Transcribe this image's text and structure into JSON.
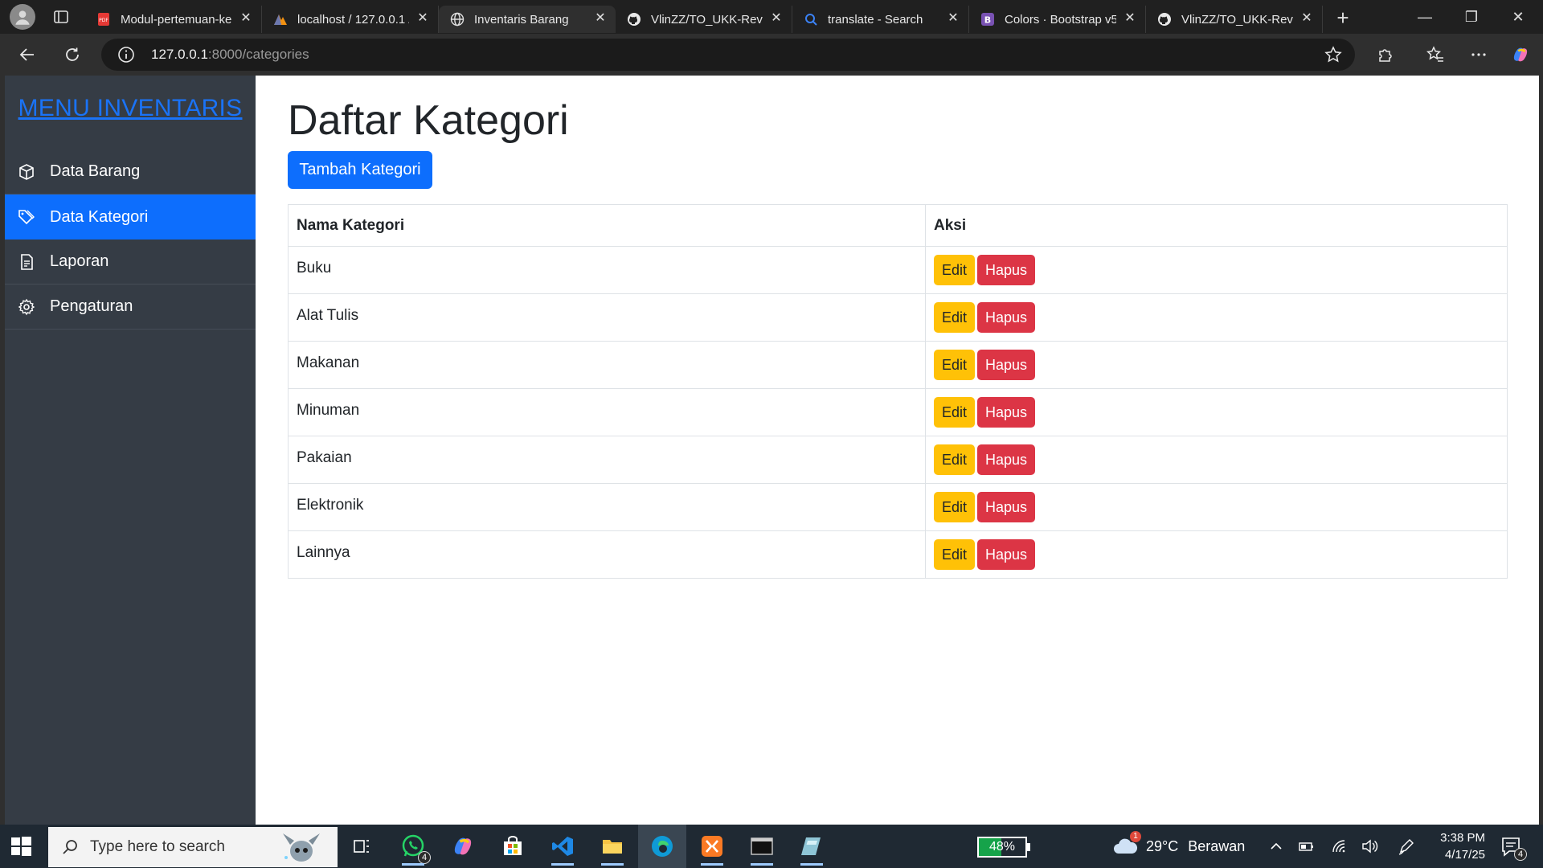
{
  "browser": {
    "tabs": [
      {
        "label": "Modul-pertemuan-ke",
        "icon": "pdf-icon",
        "active": false
      },
      {
        "label": "localhost / 127.0.0.1 /",
        "icon": "phpmyadmin-icon",
        "active": false
      },
      {
        "label": "Inventaris Barang",
        "icon": "globe-icon",
        "active": true
      },
      {
        "label": "VlinZZ/TO_UKK-Revali",
        "icon": "github-icon",
        "active": false
      },
      {
        "label": "translate - Search",
        "icon": "search-icon",
        "active": false
      },
      {
        "label": "Colors · Bootstrap v5.",
        "icon": "bootstrap-icon",
        "active": false
      },
      {
        "label": "VlinZZ/TO_UKK-Revali",
        "icon": "github-icon",
        "active": false
      }
    ],
    "tab_close_glyph": "✕",
    "new_tab_glyph": "+",
    "window_controls": {
      "minimize": "—",
      "restore": "❐",
      "close": "✕"
    },
    "url_host": "127.0.0.1",
    "url_rest": ":8000/categories"
  },
  "sidebar": {
    "brand": "MENU INVENTARIS",
    "items": [
      {
        "label": "Data Barang",
        "icon": "box-icon",
        "active": false
      },
      {
        "label": "Data Kategori",
        "icon": "tags-icon",
        "active": true
      },
      {
        "label": "Laporan",
        "icon": "file-text-icon",
        "active": false
      },
      {
        "label": "Pengaturan",
        "icon": "gear-icon",
        "active": false
      }
    ]
  },
  "main": {
    "title": "Daftar Kategori",
    "add_button": "Tambah Kategori",
    "table": {
      "headers": [
        "Nama Kategori",
        "Aksi"
      ],
      "rows": [
        "Buku",
        "Alat Tulis",
        "Makanan",
        "Minuman",
        "Pakaian",
        "Elektronik",
        "Lainnya"
      ],
      "edit_label": "Edit",
      "delete_label": "Hapus"
    }
  },
  "taskbar": {
    "search_placeholder": "Type here to search",
    "whatsapp_badge": "4",
    "battery_percent": 48,
    "battery_label": "48%",
    "weather_badge": "1",
    "temperature": "29°C",
    "weather_desc": "Berawan",
    "time": "3:38 PM",
    "date": "4/17/25",
    "notification_count": "4"
  },
  "colors": {
    "primary": "#0d6efd",
    "warning": "#ffc107",
    "danger": "#dc3545",
    "sidebar": "#353c45",
    "brand_link": "#1a73f7"
  }
}
